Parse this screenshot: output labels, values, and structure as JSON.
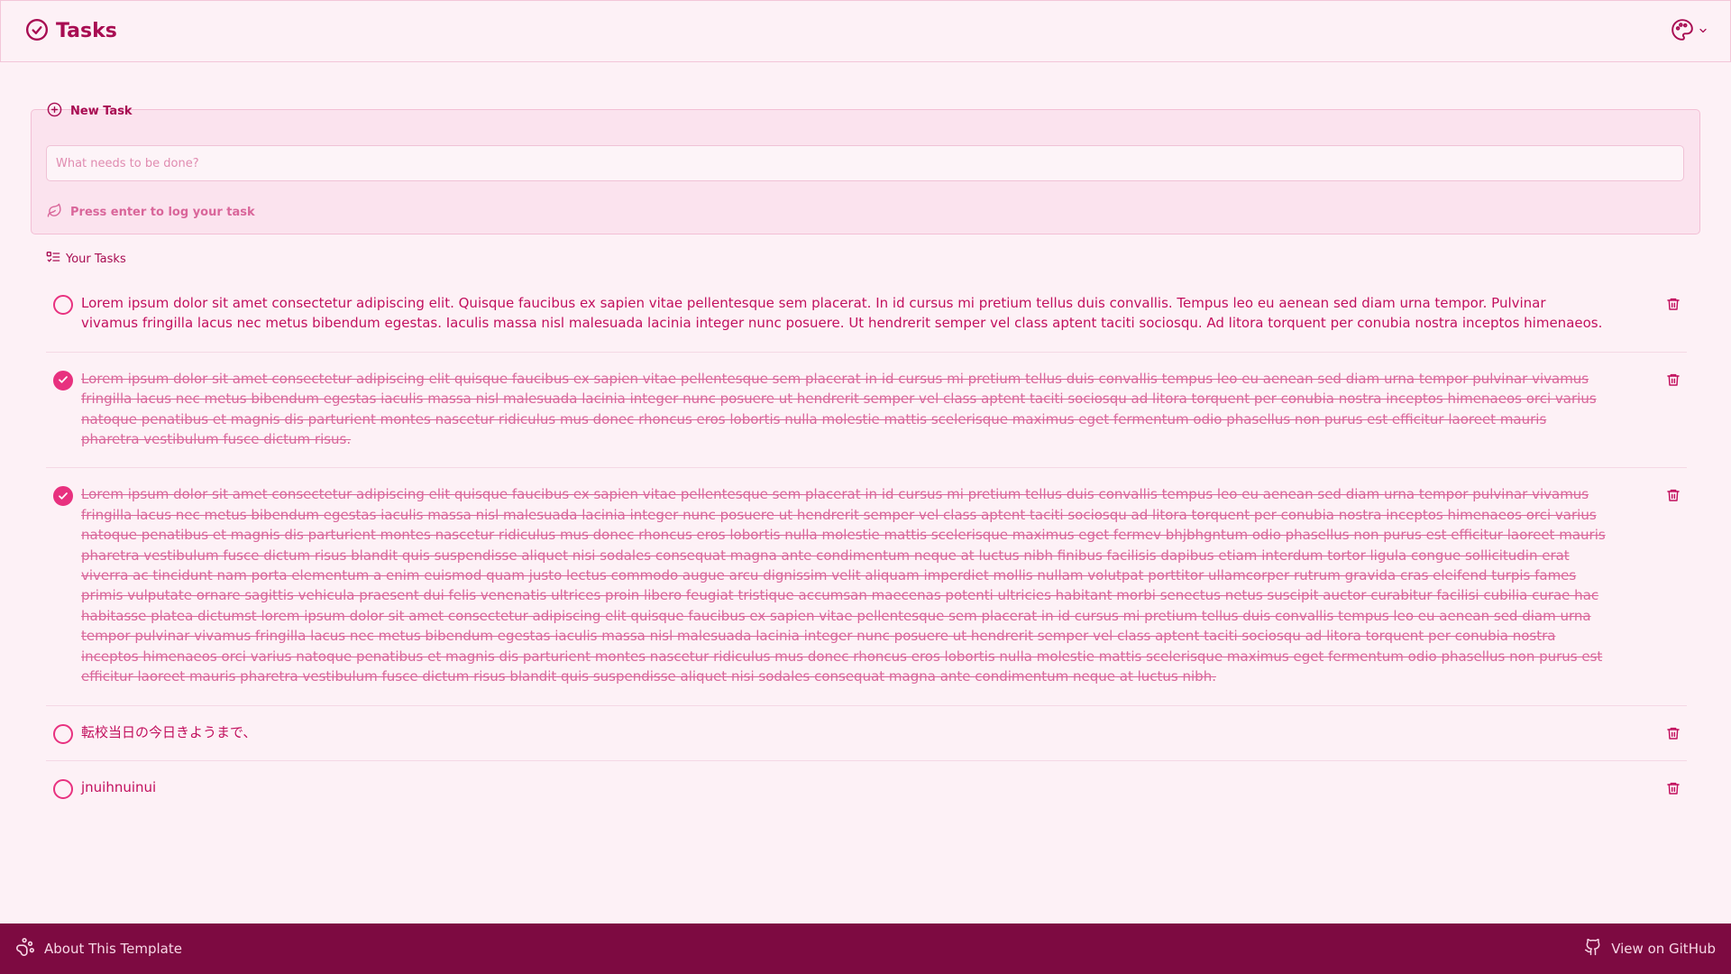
{
  "header": {
    "title": "Tasks",
    "theme_icon": "palette-icon"
  },
  "new_task": {
    "label": "New Task",
    "input_placeholder": "What needs to be done?",
    "input_value": "",
    "hint": "Press enter to log your task"
  },
  "task_list": {
    "label": "Your Tasks",
    "items": [
      {
        "text": "Lorem ipsum dolor sit amet consectetur adipiscing elit. Quisque faucibus ex sapien vitae pellentesque sem placerat. In id cursus mi pretium tellus duis convallis. Tempus leo eu aenean sed diam urna tempor. Pulvinar vivamus fringilla lacus nec metus bibendum egestas. Iaculis massa nisl malesuada lacinia integer nunc posuere. Ut hendrerit semper vel class aptent taciti sociosqu. Ad litora torquent per conubia nostra inceptos himenaeos.",
        "done": false
      },
      {
        "text": "Lorem ipsum dolor sit amet consectetur adipiscing elit quisque faucibus ex sapien vitae pellentesque sem placerat in id cursus mi pretium tellus duis convallis tempus leo eu aenean sed diam urna tempor pulvinar vivamus fringilla lacus nec metus bibendum egestas iaculis massa nisl malesuada lacinia integer nunc posuere ut hendrerit semper vel class aptent taciti sociosqu ad litora torquent per conubia nostra inceptos himenaeos orci varius natoque penatibus et magnis dis parturient montes nascetur ridiculus mus donec rhoncus eros lobortis nulla molestie mattis scelerisque maximus eget fermentum odio phasellus non purus est efficitur laoreet mauris pharetra vestibulum fusce dictum risus.",
        "done": true
      },
      {
        "text": "Lorem ipsum dolor sit amet consectetur adipiscing elit quisque faucibus ex sapien vitae pellentesque sem placerat in id cursus mi pretium tellus duis convallis tempus leo eu aenean sed diam urna tempor pulvinar vivamus fringilla lacus nec metus bibendum egestas iaculis massa nisl malesuada lacinia integer nunc posuere ut hendrerit semper vel class aptent taciti sociosqu ad litora torquent per conubia nostra inceptos himenaeos orci varius natoque penatibus et magnis dis parturient montes nascetur ridiculus mus donec rhoncus eros lobortis nulla molestie mattis scelerisque maximus eget fermev bhjbhgntum odio phasellus non purus est efficitur laoreet mauris pharetra vestibulum fusce dictum risus blandit quis suspendisse aliquet nisi sodales consequat magna ante condimentum neque at luctus nibh finibus facilisis dapibus etiam interdum tortor ligula congue sollicitudin erat viverra ac tincidunt nam porta elementum a enim euismod quam justo lectus commodo augue arcu dignissim velit aliquam imperdiet mollis nullam volutpat porttitor ullamcorper rutrum gravida cras eleifend turpis fames primis vulputate ornare sagittis vehicula praesent dui felis venenatis ultrices proin libero feugiat tristique accumsan maecenas potenti ultricies habitant morbi senectus netus suscipit auctor curabitur facilisi cubilia curae hac habitasse platea dictumst lorem ipsum dolor sit amet consectetur adipiscing elit quisque faucibus ex sapien vitae pellentesque sem placerat in id cursus mi pretium tellus duis convallis tempus leo eu aenean sed diam urna tempor pulvinar vivamus fringilla lacus nec metus bibendum egestas iaculis massa nisl malesuada lacinia integer nunc posuere ut hendrerit semper vel class aptent taciti sociosqu ad litora torquent per conubia nostra inceptos himenaeos orci varius natoque penatibus et magnis dis parturient montes nascetur ridiculus mus donec rhoncus eros lobortis nulla molestie mattis scelerisque maximus eget fermentum odio phasellus non purus est efficitur laoreet mauris pharetra vestibulum fusce dictum risus blandit quis suspendisse aliquet nisi sodales consequat magna ante condimentum neque at luctus nibh.",
        "done": true
      },
      {
        "text": "転校当日の今日きようまで、",
        "done": false
      },
      {
        "text": "jnuihnuinui",
        "done": false
      }
    ]
  },
  "footer": {
    "about_label": "About This Template",
    "github_label": "View on GitHub"
  },
  "colors": {
    "background": "#fdf1f6",
    "primary": "#c2105e",
    "accent": "#e8317f",
    "footer_bg": "#7d0a41"
  }
}
